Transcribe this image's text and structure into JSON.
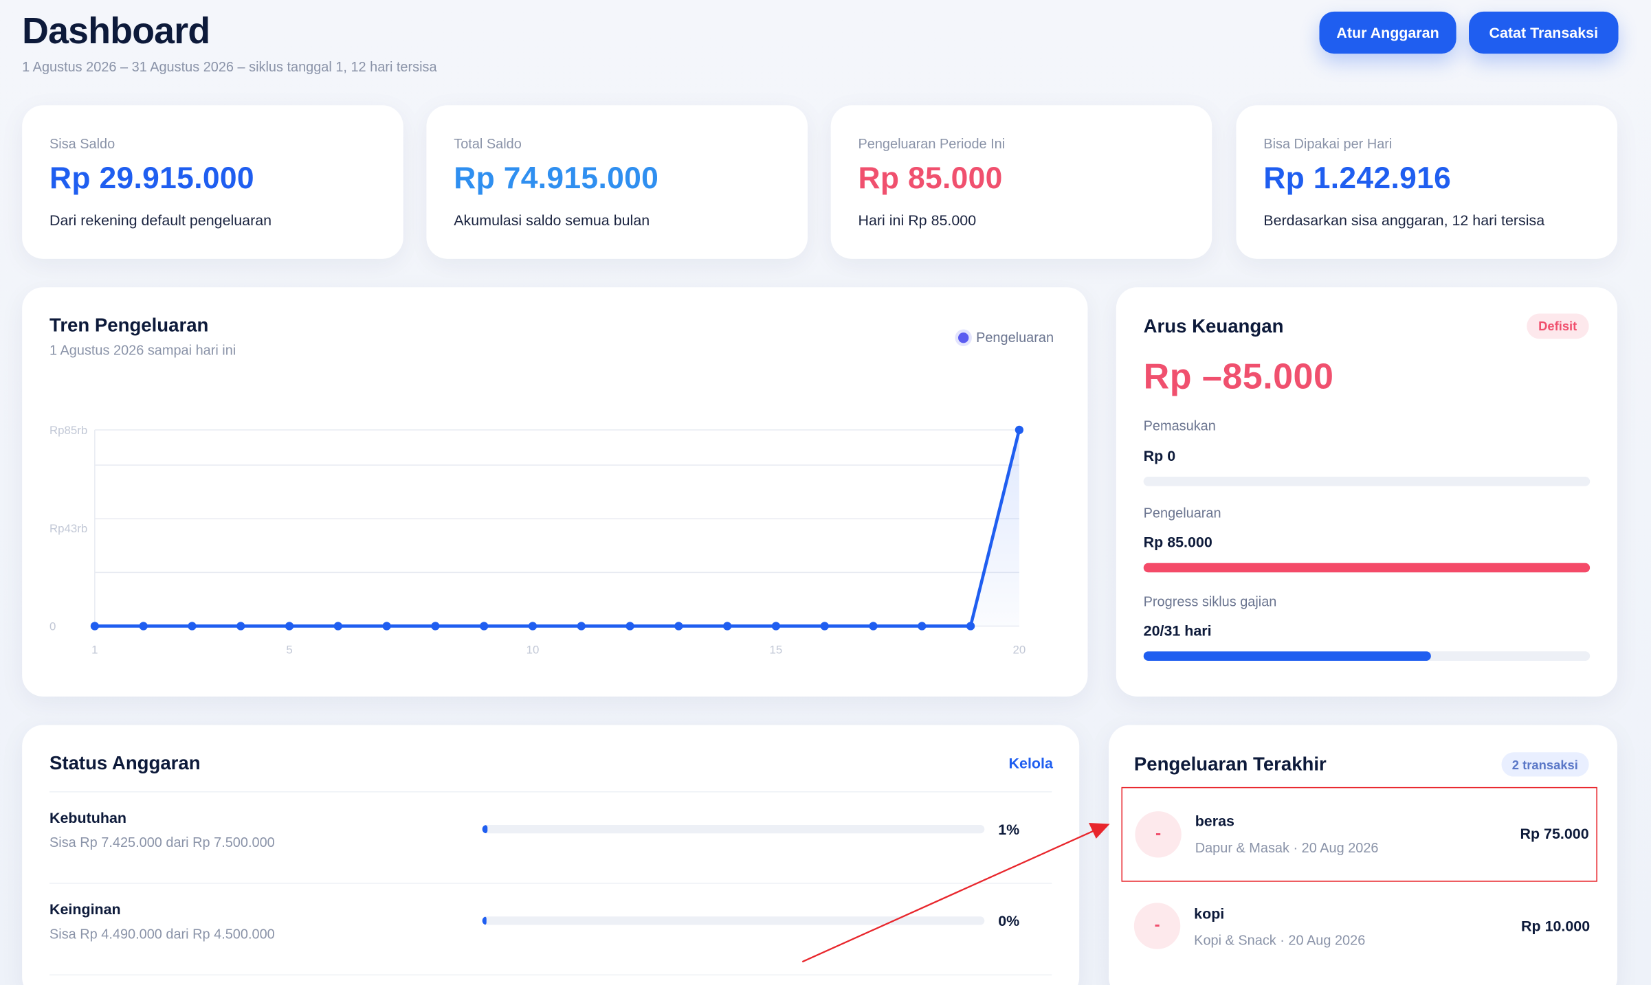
{
  "header": {
    "title": "Dashboard",
    "subtitle": "1 Agustus 2026 – 31 Agustus 2026 – siklus tanggal 1, 12 hari tersisa",
    "btn_budget": "Atur Anggaran",
    "btn_transaction": "Catat Transaksi"
  },
  "stats": [
    {
      "label": "Sisa Saldo",
      "value": "Rp 29.915.000",
      "desc": "Dari rekening default pengeluaran",
      "color": "#1f5ef0"
    },
    {
      "label": "Total Saldo",
      "value": "Rp 74.915.000",
      "desc": "Akumulasi saldo semua bulan",
      "color": "#2f8ff0"
    },
    {
      "label": "Pengeluaran Periode Ini",
      "value": "Rp 85.000",
      "desc": "Hari ini Rp 85.000",
      "color": "#f0506e"
    },
    {
      "label": "Bisa Dipakai per Hari",
      "value": "Rp 1.242.916",
      "desc": "Berdasarkan sisa anggaran, 12 hari tersisa",
      "color": "#1f5ef0"
    }
  ],
  "trend": {
    "title": "Tren Pengeluaran",
    "subtitle": "1 Agustus 2026 sampai hari ini",
    "legend": "Pengeluaran"
  },
  "chart_data": {
    "type": "line",
    "title": "Tren Pengeluaran",
    "x": [
      1,
      2,
      3,
      4,
      5,
      6,
      7,
      8,
      9,
      10,
      11,
      12,
      13,
      14,
      15,
      16,
      17,
      18,
      19,
      20
    ],
    "series": [
      {
        "name": "Pengeluaran",
        "values": [
          0,
          0,
          0,
          0,
          0,
          0,
          0,
          0,
          0,
          0,
          0,
          0,
          0,
          0,
          0,
          0,
          0,
          0,
          0,
          85000
        ]
      }
    ],
    "ytick_labels": [
      "0",
      "Rp43rb",
      "Rp85rb"
    ],
    "ytick_values": [
      0,
      42500,
      85000
    ],
    "xticks": [
      1,
      5,
      10,
      15,
      20
    ],
    "ylim": [
      0,
      93000
    ],
    "color": "#1f5ef0",
    "grid": true
  },
  "cashflow": {
    "title": "Arus Keuangan",
    "badge": "Defisit",
    "net": "Rp –85.000",
    "income_label": "Pemasukan",
    "income_value": "Rp 0",
    "income_fraction": 0,
    "expense_label": "Pengeluaran",
    "expense_value": "Rp 85.000",
    "expense_fraction": 1,
    "cycle_label": "Progress siklus gajian",
    "cycle_value": "20/31 hari",
    "cycle_fraction": 0.645
  },
  "budget": {
    "title": "Status Anggaran",
    "link": "Kelola",
    "items": [
      {
        "name": "Kebutuhan",
        "sub": "Sisa Rp 7.425.000 dari Rp 7.500.000",
        "pct": "1%",
        "fraction": 0.01
      },
      {
        "name": "Keinginan",
        "sub": "Sisa Rp 4.490.000 dari Rp 4.500.000",
        "pct": "0%",
        "fraction": 0.0
      }
    ]
  },
  "recent": {
    "title": "Pengeluaran Terakhir",
    "badge": "2 transaksi",
    "items": [
      {
        "icon": "-",
        "name": "beras",
        "sub": "Dapur & Masak · 20 Aug 2026",
        "amount": "Rp 75.000"
      },
      {
        "icon": "-",
        "name": "kopi",
        "sub": "Kopi & Snack · 20 Aug 2026",
        "amount": "Rp 10.000"
      }
    ]
  }
}
